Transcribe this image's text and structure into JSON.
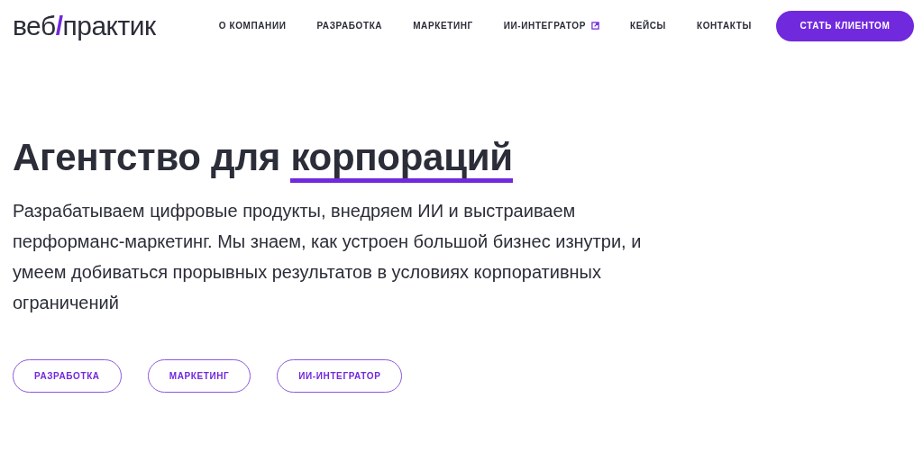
{
  "logo": {
    "before": "веб",
    "mark": "/",
    "after": "практик"
  },
  "nav": [
    {
      "label": "О КОМПАНИИ",
      "external": false
    },
    {
      "label": "РАЗРАБОТКА",
      "external": false
    },
    {
      "label": "МАРКЕТИНГ",
      "external": false
    },
    {
      "label": "ИИ-ИНТЕГРАТОР",
      "external": true
    },
    {
      "label": "КЕЙСЫ",
      "external": false
    },
    {
      "label": "КОНТАКТЫ",
      "external": false
    }
  ],
  "cta": "СТАТЬ КЛИЕНТОМ",
  "hero": {
    "title": "Агентство для",
    "highlight": "корпораций",
    "description": "Разрабатываем цифровые продукты, внедряем ИИ и выстраиваем перформанс-маркетинг. Мы знаем, как устроен большой бизнес изнутри, и умеем добиваться прорывных результатов в условиях корпоративных ограничений",
    "buttons": [
      "РАЗРАБОТКА",
      "МАРКЕТИНГ",
      "ИИ-ИНТЕГРАТОР"
    ]
  }
}
